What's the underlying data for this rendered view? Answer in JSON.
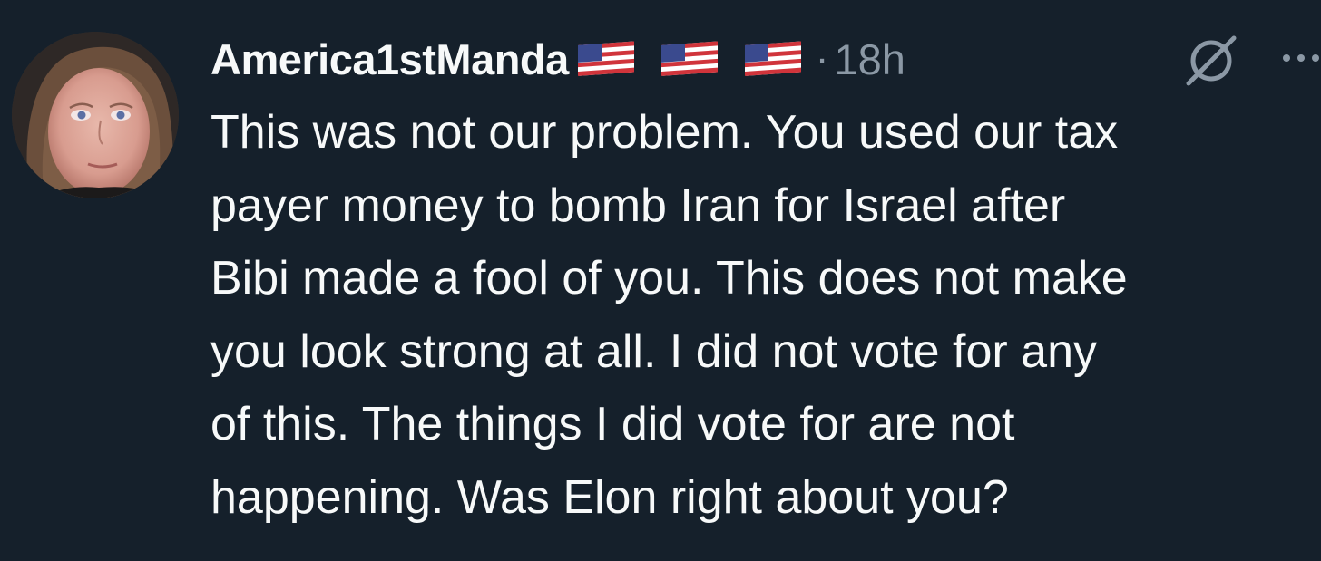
{
  "post": {
    "username": "America1stManda",
    "flags": [
      "us-flag",
      "us-flag",
      "us-flag"
    ],
    "separator": "·",
    "timestamp": "18h",
    "text_lines": [
      "This was not our problem. You used our tax",
      "payer money to bomb Iran for Israel after",
      "Bibi made a fool of you. This does not make",
      "you look strong at all. I did not vote for any",
      "of this. The things I did vote for are not",
      "happening. Was Elon right about you?"
    ]
  },
  "icons": {
    "avatar": "profile-photo",
    "grok": "grok-icon",
    "more": "more-icon"
  },
  "colors": {
    "background": "#15202b",
    "text_primary": "#f7f9f9",
    "text_secondary": "#8b98a5"
  }
}
